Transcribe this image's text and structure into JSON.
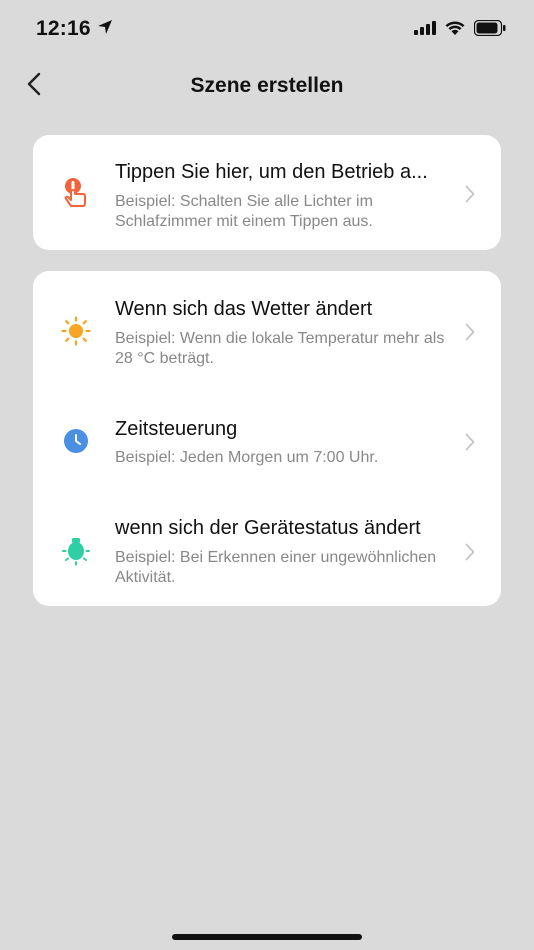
{
  "status": {
    "time": "12:16"
  },
  "header": {
    "title": "Szene erstellen"
  },
  "tap_card": {
    "title": "Tippen Sie hier, um den Betrieb a...",
    "desc": "Beispiel: Schalten Sie alle Lichter im Schlafzimmer mit einem Tippen aus.",
    "icon": "tap-hand-icon",
    "icon_color": "#f2643c"
  },
  "conditions": [
    {
      "title": "Wenn sich das Wetter ändert",
      "desc": "Beispiel: Wenn die lokale Temperatur mehr als 28 °C beträgt.",
      "icon": "sun-icon",
      "icon_color": "#f6a623"
    },
    {
      "title": "Zeitsteuerung",
      "desc": "Beispiel: Jeden Morgen um 7:00 Uhr.",
      "icon": "clock-icon",
      "icon_color": "#4a8fe2"
    },
    {
      "title": "wenn sich der Gerätestatus ändert",
      "desc": "Beispiel: Bei Erkennen einer ungewöhnlichen Aktivität.",
      "icon": "device-bulb-icon",
      "icon_color": "#2fcfa4"
    }
  ]
}
